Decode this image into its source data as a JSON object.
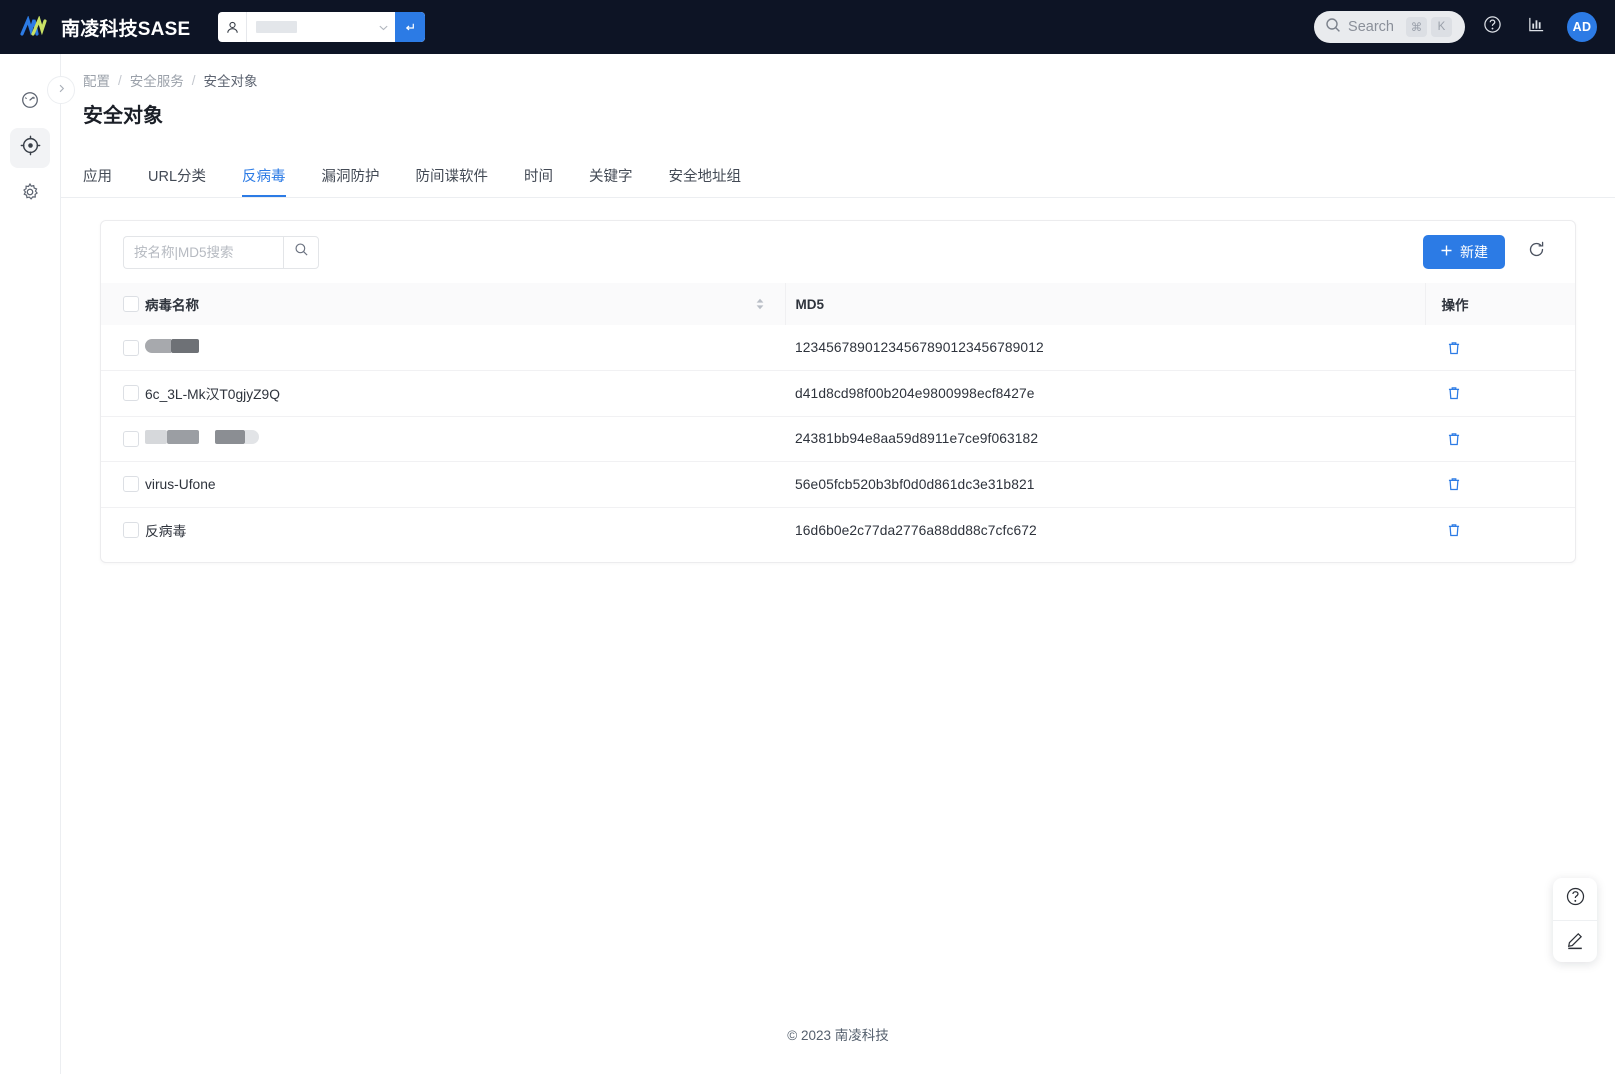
{
  "header": {
    "brand_name": "南凌科技SASE",
    "logo_icon": "m-logo-icon",
    "tenant": {
      "user_icon": "user-icon",
      "value": "",
      "caret_icon": "chevron-down-icon",
      "go_icon": "enter-arrow-icon"
    },
    "search": {
      "icon": "search-icon",
      "label": "Search",
      "key_modifier": "⌘",
      "key_letter": "K"
    },
    "help_icon": "question-circle-icon",
    "report_icon": "bar-chart-icon",
    "avatar_initials": "AD",
    "accent_color": "#2c7be5",
    "background_color": "#0d1425"
  },
  "rail": {
    "toggle_icon": "chevron-right-icon",
    "items": [
      {
        "name": "dashboard",
        "icon": "gauge-icon",
        "active": false
      },
      {
        "name": "security",
        "icon": "target-icon",
        "active": true
      },
      {
        "name": "settings",
        "icon": "gear-icon",
        "active": false
      }
    ]
  },
  "breadcrumb": [
    "配置",
    "安全服务",
    "安全对象"
  ],
  "page": {
    "title": "安全对象"
  },
  "tabs": [
    {
      "label": "应用",
      "active": false
    },
    {
      "label": "URL分类",
      "active": false
    },
    {
      "label": "反病毒",
      "active": true
    },
    {
      "label": "漏洞防护",
      "active": false
    },
    {
      "label": "防间谍软件",
      "active": false
    },
    {
      "label": "时间",
      "active": false
    },
    {
      "label": "关键字",
      "active": false
    },
    {
      "label": "安全地址组",
      "active": false
    }
  ],
  "toolbar": {
    "search_placeholder": "按名称|MD5搜索",
    "search_value": "",
    "search_icon": "search-icon",
    "new_label": "新建",
    "new_icon": "plus-icon",
    "refresh_icon": "refresh-icon"
  },
  "table": {
    "columns": [
      {
        "key": "name",
        "label": "病毒名称",
        "sortable": true
      },
      {
        "key": "md5",
        "label": "MD5",
        "sortable": false
      },
      {
        "key": "action",
        "label": "操作",
        "sortable": false
      }
    ],
    "select_all_checked": false,
    "sort_icon": "sort-arrows-icon",
    "delete_icon": "trash-icon",
    "rows": [
      {
        "checked": false,
        "name": "",
        "name_redacted": true,
        "md5": "12345678901234567890123456789012"
      },
      {
        "checked": false,
        "name": "6c_3L-Mk汉T0gjyZ9Q",
        "name_redacted": false,
        "md5": "d41d8cd98f00b204e9800998ecf8427e"
      },
      {
        "checked": false,
        "name": "",
        "name_redacted": true,
        "md5": "24381bb94e8aa59d8911e7ce9f063182"
      },
      {
        "checked": false,
        "name": "virus-Ufone",
        "name_redacted": false,
        "md5": "56e05fcb520b3bf0d0d861dc3e31b821"
      },
      {
        "checked": false,
        "name": "反病毒",
        "name_redacted": false,
        "md5": "16d6b0e2c77da2776a88dd88c7cfc672"
      }
    ]
  },
  "footer": {
    "copyright": "© 2023 南凌科技"
  },
  "fab": [
    {
      "name": "help",
      "icon": "question-circle-icon"
    },
    {
      "name": "feedback",
      "icon": "pencil-icon"
    }
  ]
}
